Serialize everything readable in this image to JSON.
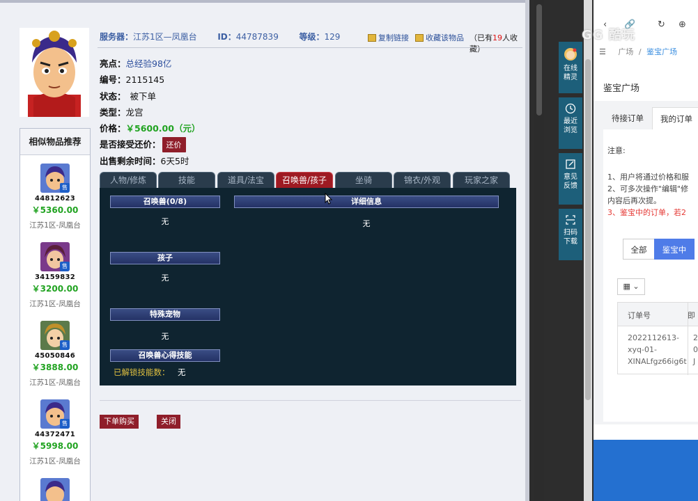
{
  "header": {
    "server_label": "服务器：",
    "server_value": "江苏1区—凤凰台",
    "id_label": "ID：",
    "id_value": "44787839",
    "level_label": "等级：",
    "level_value": "129",
    "copy_link": "复制链接",
    "favorite": "收藏该物品",
    "fav_prefix": "（已有",
    "fav_count": "19",
    "fav_suffix": "人收藏）"
  },
  "info": {
    "highlight_label": "亮点：",
    "highlight_value": "总经验98亿",
    "number_label": "编号：",
    "number_value": "2115145",
    "status_label": "状态：",
    "status_value": "被下单",
    "type_label": "类型：",
    "type_value": "龙宫",
    "price_label": "价格：",
    "price_value": "￥5600.00（元）",
    "counter_label": "是否接受还价：",
    "counter_button": "还价",
    "remaining_label": "出售剩余时间：",
    "remaining_value": "6天5时"
  },
  "tabs": [
    "人物/修炼",
    "技能",
    "道具/法宝",
    "召唤兽/孩子",
    "坐骑",
    "锦衣/外观",
    "玩家之家"
  ],
  "panel": {
    "summon_title": "召唤兽(0/8)",
    "summon_value": "无",
    "detail_title": "详细信息",
    "detail_value": "无",
    "child_title": "孩子",
    "child_value": "无",
    "special_title": "特殊宠物",
    "special_value": "无",
    "skills_title": "召唤兽心得技能",
    "unlock_label": "已解锁技能数：",
    "unlock_value": "无"
  },
  "actions": {
    "buy": "下单购买",
    "close": "关闭"
  },
  "similar": {
    "title": "相似物品推荐",
    "badge": "售",
    "items": [
      {
        "id": "44812623",
        "price": "￥5360.00",
        "server": "江苏1区-凤凰台"
      },
      {
        "id": "34159832",
        "price": "￥3200.00",
        "server": "江苏1区-凤凰台"
      },
      {
        "id": "45050846",
        "price": "￥3888.00",
        "server": "江苏1区-凤凰台"
      },
      {
        "id": "44372471",
        "price": "￥5998.00",
        "server": "江苏1区-凤凰台"
      }
    ]
  },
  "side_toolbar": {
    "online": "在线精灵",
    "recent": "最近浏览",
    "feedback": "意见反馈",
    "scan": "扫码下载"
  },
  "right_panel": {
    "watermark": "GG 酷玩",
    "crumb_home": "广场",
    "crumb_sep": "/",
    "crumb_current": "鉴宝广场",
    "heading": "鉴宝广场",
    "tab_pending": "待接订单",
    "tab_mine": "我的订单",
    "notes_title": "注意:",
    "note1": "1、用户将通过价格和服",
    "note2": "2、可多次操作\"编辑\"修",
    "note2b": "内容后再次提。",
    "note3": "3、鉴宝中的订单，若2",
    "filter_all": "全部",
    "filter_active": "鉴宝中",
    "grid_icon": "▦ ⌄",
    "th_order": "订单号",
    "th_col2": "即",
    "row_order_1": "2022112613-",
    "row_order_2": "xyq-01-",
    "row_order_3": "XINALfgz66ig6t",
    "row_col2_1": "2",
    "row_col2_2": "0",
    "row_col2_3": "J"
  }
}
